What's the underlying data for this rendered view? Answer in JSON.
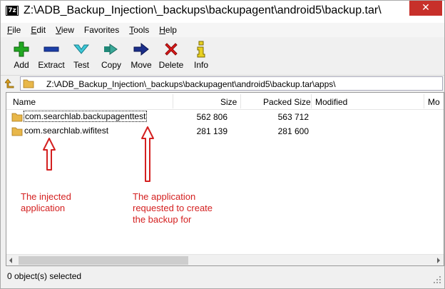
{
  "window": {
    "title": "Z:\\ADB_Backup_Injection\\_backups\\backupagent\\android5\\backup.tar\\",
    "app_icon": "7z",
    "close_glyph": "✕"
  },
  "menu": [
    {
      "label": "File",
      "u": "F",
      "rest": "ile"
    },
    {
      "label": "Edit",
      "u": "E",
      "rest": "dit"
    },
    {
      "label": "View",
      "u": "V",
      "rest": "iew"
    },
    {
      "label": "Favorites",
      "u": "",
      "rest": "Favorites"
    },
    {
      "label": "Tools",
      "u": "T",
      "rest": "ools"
    },
    {
      "label": "Help",
      "u": "H",
      "rest": "elp"
    }
  ],
  "toolbar": {
    "add": "Add",
    "extract": "Extract",
    "test": "Test",
    "copy": "Copy",
    "move": "Move",
    "delete": "Delete",
    "info": "Info"
  },
  "path": {
    "value": "Z:\\ADB_Backup_Injection\\_backups\\backupagent\\android5\\backup.tar\\apps\\"
  },
  "columns": {
    "name": "Name",
    "size": "Size",
    "packed": "Packed Size",
    "modified": "Modified",
    "mode": "Mo"
  },
  "rows": [
    {
      "name": "com.searchlab.backupagenttest",
      "size": "562 806",
      "packed": "563 712"
    },
    {
      "name": "com.searchlab.wifitest",
      "size": "281 139",
      "packed": "281 600"
    }
  ],
  "status": {
    "text": "0 object(s) selected"
  },
  "annotations": {
    "left": "The injected\napplication",
    "right": "The application\nrequested to create\nthe backup for",
    "color": "#d42020"
  },
  "colors": {
    "folder": "#e8b74a",
    "annotation": "#d42020",
    "add_green": "#22a822",
    "extract_blue": "#1b3fa8",
    "delete_red": "#e01a1a"
  }
}
